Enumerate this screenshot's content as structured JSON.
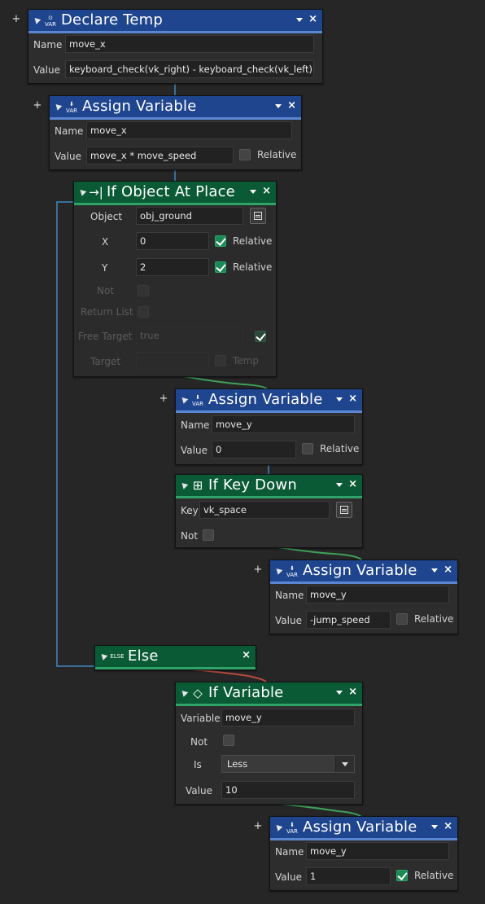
{
  "nodes": {
    "declare_temp": {
      "title": "Declare Temp",
      "icon": "var-icon",
      "name_label": "Name",
      "name_value": "move_x",
      "value_label": "Value",
      "value_value": "keyboard_check(vk_right) - keyboard_check(vk_left)"
    },
    "assign_1": {
      "title": "Assign Variable",
      "name_label": "Name",
      "name_value": "move_x",
      "value_label": "Value",
      "value_value": "move_x * move_speed",
      "relative_label": "Relative",
      "relative_checked": false
    },
    "if_object": {
      "title": "If Object At Place",
      "object_label": "Object",
      "object_value": "obj_ground",
      "x_label": "X",
      "x_value": "0",
      "x_relative_label": "Relative",
      "y_label": "Y",
      "y_value": "2",
      "y_relative_label": "Relative",
      "not_label": "Not",
      "return_list_label": "Return List",
      "free_target_label": "Free Target",
      "free_target_value": "true",
      "target_label": "Target",
      "temp_label": "Temp"
    },
    "assign_2": {
      "title": "Assign Variable",
      "name_label": "Name",
      "name_value": "move_y",
      "value_label": "Value",
      "value_value": "0",
      "relative_label": "Relative"
    },
    "if_key": {
      "title": "If Key Down",
      "key_label": "Key",
      "key_value": "vk_space",
      "not_label": "Not"
    },
    "assign_3": {
      "title": "Assign Variable",
      "name_label": "Name",
      "name_value": "move_y",
      "value_label": "Value",
      "value_value": "-jump_speed",
      "relative_label": "Relative"
    },
    "else": {
      "title": "Else",
      "icon_text": "ELSE"
    },
    "if_variable": {
      "title": "If Variable",
      "variable_label": "Variable",
      "variable_value": "move_y",
      "not_label": "Not",
      "is_label": "Is",
      "is_value": "Less",
      "value_label": "Value",
      "value_value": "10"
    },
    "assign_4": {
      "title": "Assign Variable",
      "name_label": "Name",
      "name_value": "move_y",
      "value_label": "Value",
      "value_value": "1",
      "relative_label": "Relative"
    }
  },
  "icon_text": {
    "var": "VAR"
  },
  "colors": {
    "background": "#262626",
    "header_blue": "#1f458f",
    "header_green": "#0a5a35",
    "wire_blue": "#3a6f9a",
    "wire_green": "#3fa05a",
    "wire_red": "#b84a40"
  }
}
